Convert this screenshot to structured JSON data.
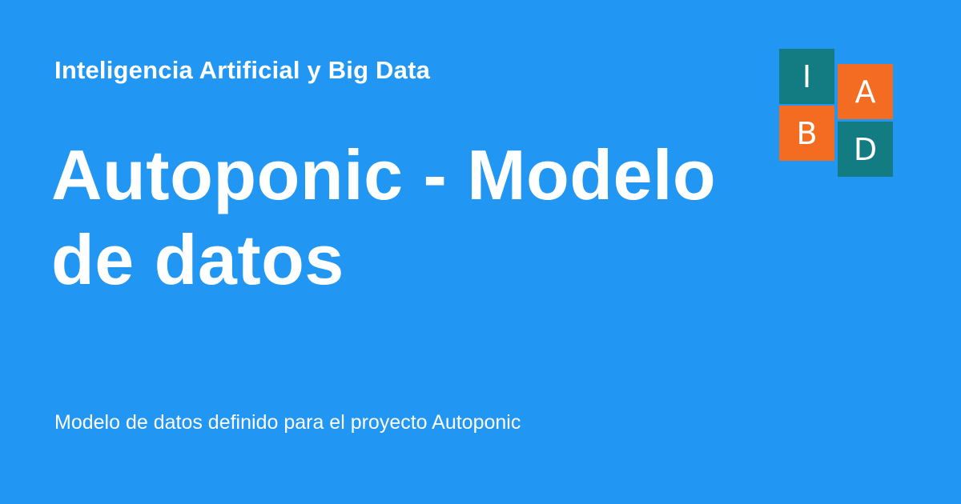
{
  "site": {
    "name": "Inteligencia Artificial y Big Data"
  },
  "page": {
    "title": "Autoponic - Modelo de datos",
    "description": "Modelo de datos definido para el proyecto Autoponic"
  },
  "logo": {
    "tiles": [
      {
        "letter": "I",
        "color": "#127c82"
      },
      {
        "letter": "A",
        "color": "#f36c21"
      },
      {
        "letter": "B",
        "color": "#f36c21"
      },
      {
        "letter": "D",
        "color": "#127c82"
      }
    ]
  },
  "colors": {
    "background": "#2196f3",
    "text": "#ffffff"
  }
}
